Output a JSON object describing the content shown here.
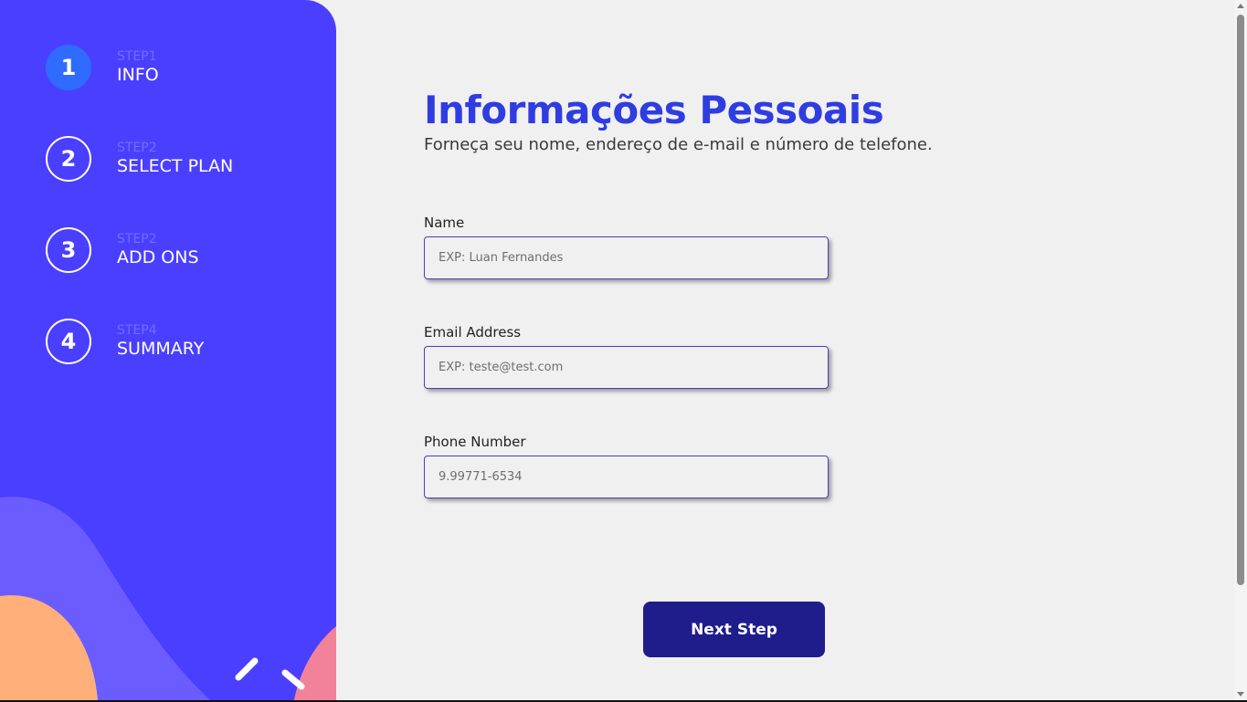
{
  "sidebar": {
    "steps": [
      {
        "number": "1",
        "small": "STEP1",
        "label": "INFO",
        "active": true
      },
      {
        "number": "2",
        "small": "STEP2",
        "label": "SELECT PLAN",
        "active": false
      },
      {
        "number": "3",
        "small": "STEP2",
        "label": "ADD ONS",
        "active": false
      },
      {
        "number": "4",
        "small": "STEP4",
        "label": "SUMMARY",
        "active": false
      }
    ]
  },
  "main": {
    "title": "Informações Pessoais",
    "subtitle": "Forneça seu nome, endereço de e-mail e número de telefone.",
    "fields": [
      {
        "label": "Name",
        "placeholder": "EXP: Luan Fernandes",
        "value": ""
      },
      {
        "label": "Email Address",
        "placeholder": "EXP: teste@test.com",
        "value": ""
      },
      {
        "label": "Phone Number",
        "placeholder": "9.99771-6534",
        "value": ""
      }
    ],
    "next_button": "Next Step"
  },
  "colors": {
    "sidebar_bg": "#4a3fff",
    "active_step": "#2f6bff",
    "title": "#2f3de0",
    "button_bg": "#1f1c8c"
  }
}
